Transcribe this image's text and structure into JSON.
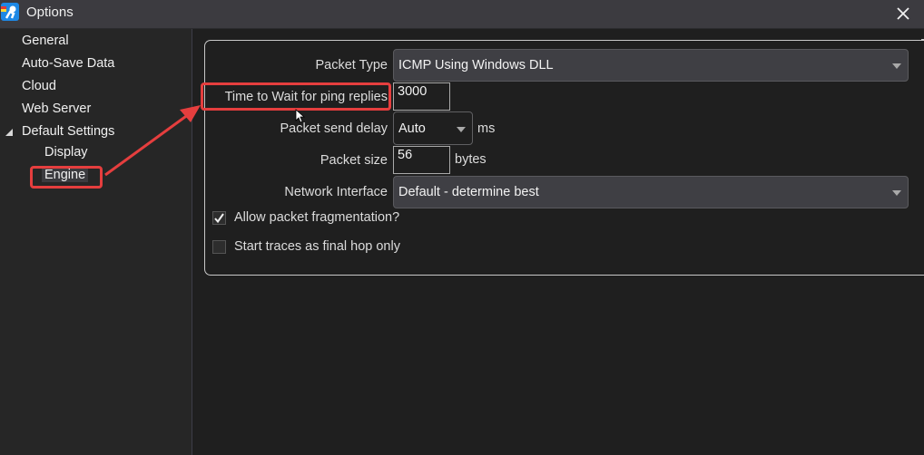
{
  "window": {
    "title": "Options",
    "app_icon": "app-logo-icon",
    "close_icon": "close-icon"
  },
  "sidebar": {
    "items": [
      {
        "label": "General",
        "level": 0
      },
      {
        "label": "Auto-Save Data",
        "level": 0
      },
      {
        "label": "Cloud",
        "level": 0
      },
      {
        "label": "Web Server",
        "level": 0
      },
      {
        "label": "Default Settings",
        "level": 0,
        "expanded": true
      },
      {
        "label": "Display",
        "level": 1
      },
      {
        "label": "Engine",
        "level": 1,
        "selected": true
      }
    ]
  },
  "engine": {
    "packet_type": {
      "label": "Packet Type",
      "value": "ICMP Using Windows DLL"
    },
    "wait_time": {
      "label": "Time to Wait for ping replies",
      "value": "3000"
    },
    "send_delay": {
      "label": "Packet send delay",
      "value": "Auto",
      "unit": "ms"
    },
    "packet_size": {
      "label": "Packet size",
      "value": "56",
      "unit": "bytes"
    },
    "network_interface": {
      "label": "Network Interface",
      "value": "Default - determine best"
    },
    "allow_fragmentation": {
      "label": "Allow packet fragmentation?",
      "checked": true
    },
    "final_hop_only": {
      "label": "Start traces as final hop only",
      "checked": false
    }
  },
  "annotations": {
    "highlight_color": "#e53e3e",
    "note": "Arrow from Engine to Time to Wait for ping replies"
  }
}
